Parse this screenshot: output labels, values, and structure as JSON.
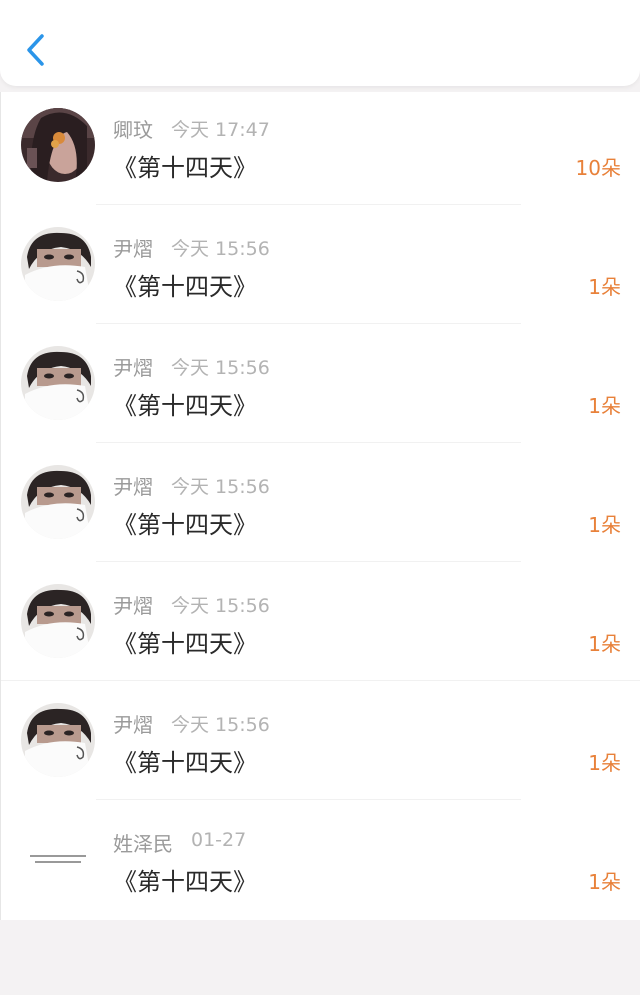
{
  "header": {
    "back_icon": "chevron-left-icon",
    "accent_color": "#2b95e9"
  },
  "entries": [
    {
      "name": "卿玟",
      "time": "今天 17:47",
      "title": "《第十四天》",
      "amount": "10朵",
      "avatar": "girl-portrait"
    },
    {
      "name": "尹熠",
      "time": "今天 15:56",
      "title": "《第十四天》",
      "amount": "1朵",
      "avatar": "masked-boy-portrait"
    },
    {
      "name": "尹熠",
      "time": "今天 15:56",
      "title": "《第十四天》",
      "amount": "1朵",
      "avatar": "masked-boy-portrait"
    },
    {
      "name": "尹熠",
      "time": "今天 15:56",
      "title": "《第十四天》",
      "amount": "1朵",
      "avatar": "masked-boy-portrait"
    },
    {
      "name": "尹熠",
      "time": "今天 15:56",
      "title": "《第十四天》",
      "amount": "1朵",
      "avatar": "masked-boy-portrait"
    },
    {
      "name": "尹熠",
      "time": "今天 15:56",
      "title": "《第十四天》",
      "amount": "1朵",
      "avatar": "masked-boy-portrait"
    },
    {
      "name": "姓泽民",
      "time": "01-27",
      "title": "《第十四天》",
      "amount": "1朵",
      "avatar": "text-note-image"
    }
  ],
  "colors": {
    "name": "#9a9a9a",
    "time": "#b3b3b3",
    "title": "#2a2a2a",
    "amount": "#e8813a",
    "background": "#f4f2f3"
  }
}
